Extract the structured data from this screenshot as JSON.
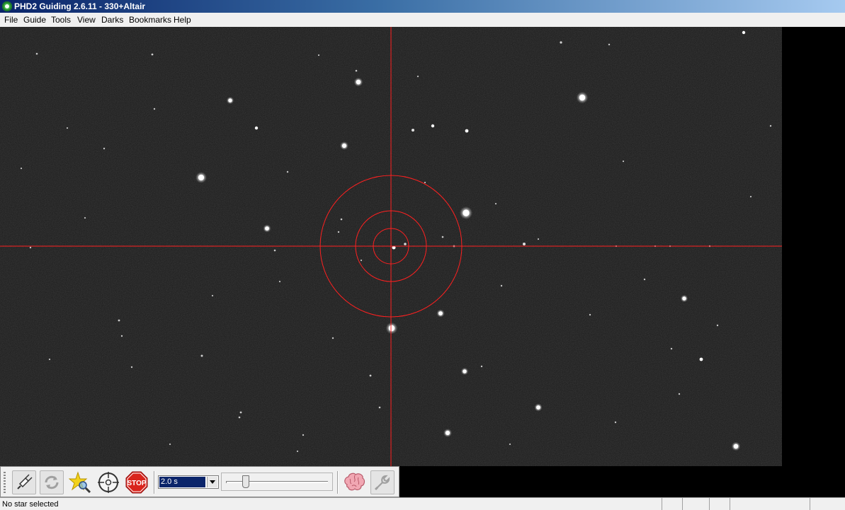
{
  "window": {
    "title": "PHD2 Guiding 2.6.11 - 330+Altair"
  },
  "menu": [
    "File",
    "Guide",
    "Tools",
    "View",
    "Darks",
    "Bookmarks",
    "Help"
  ],
  "toolbar": {
    "buttons": [
      {
        "name": "connect-equipment-button",
        "icon": "usb-plug-icon"
      },
      {
        "name": "loop-exposures-button",
        "icon": "loop-arrows-icon"
      },
      {
        "name": "auto-select-star-button",
        "icon": "star-magnifier-icon"
      },
      {
        "name": "guide-button",
        "icon": "crosshair-target-icon"
      },
      {
        "name": "stop-button",
        "icon": "stop-sign-icon"
      },
      {
        "name": "brain-settings-button",
        "icon": "brain-icon"
      },
      {
        "name": "manual-guide-button",
        "icon": "wrench-icon"
      }
    ],
    "stop_label": "STOP",
    "exposure": {
      "value": "2.0 s"
    },
    "gamma_slider": {
      "level": 0.17
    }
  },
  "status": {
    "text": "No star selected"
  },
  "colors": {
    "reticle": "#ff2020",
    "sky": "#1c1c1c",
    "star": "#ffffff"
  }
}
